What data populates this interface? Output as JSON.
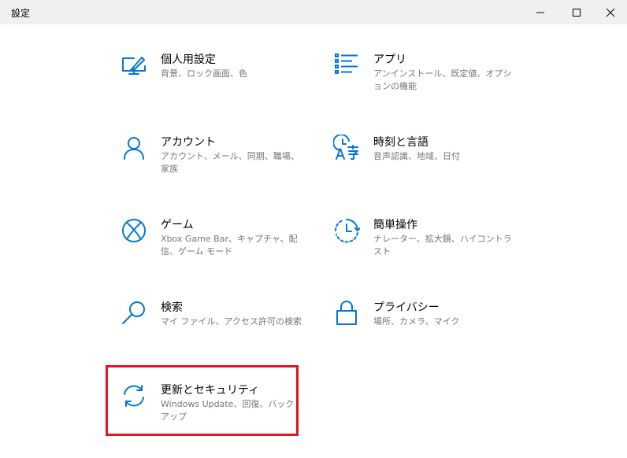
{
  "window": {
    "title": "設定"
  },
  "colors": {
    "accent": "#0078d7",
    "highlight": "#e81123",
    "description": "#767676"
  },
  "tiles": [
    {
      "name": "個人用設定",
      "desc": "背景、ロック画面、色",
      "icon": "personalization-icon"
    },
    {
      "name": "アプリ",
      "desc": "アンインストール、既定値、オプションの機能",
      "icon": "apps-icon"
    },
    {
      "name": "アカウント",
      "desc": "アカウント、メール、同期、職場、家族",
      "icon": "accounts-icon"
    },
    {
      "name": "時刻と言語",
      "desc": "音声認識、地域、日付",
      "icon": "time-language-icon"
    },
    {
      "name": "ゲーム",
      "desc": "Xbox Game Bar、キャプチャ、配信、ゲーム モード",
      "icon": "xbox-icon"
    },
    {
      "name": "簡単操作",
      "desc": "ナレーター、拡大鏡、ハイコントラスト",
      "icon": "ease-of-access-icon"
    },
    {
      "name": "検索",
      "desc": "マイ ファイル、アクセス許可の検索",
      "icon": "search-icon"
    },
    {
      "name": "プライバシー",
      "desc": "場所、カメラ、マイク",
      "icon": "lock-icon"
    },
    {
      "name": "更新とセキュリティ",
      "desc": "Windows Update、回復、バックアップ",
      "icon": "update-sync-icon"
    }
  ]
}
